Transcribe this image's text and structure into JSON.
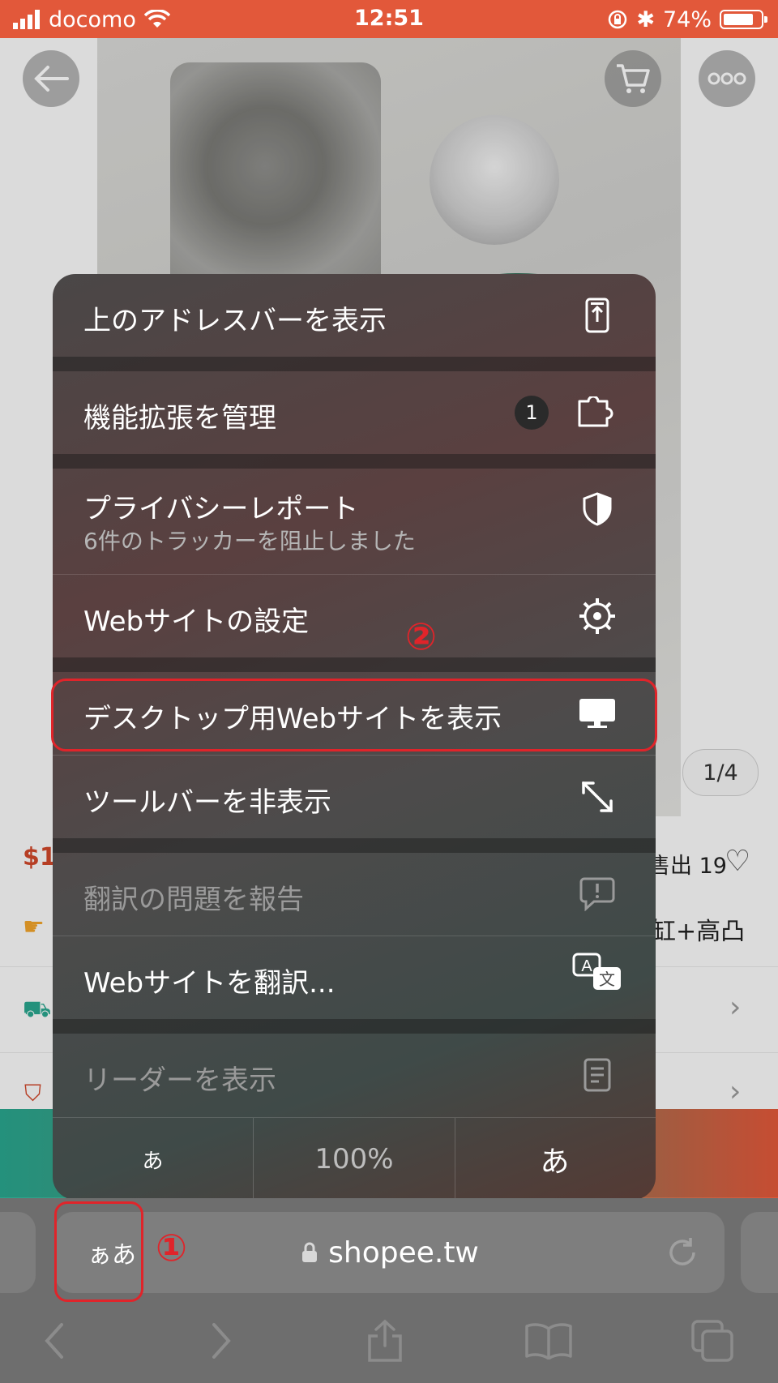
{
  "status_bar": {
    "carrier": "docomo",
    "time": "12:51",
    "battery": "74%"
  },
  "page": {
    "image_counter": "1/4",
    "price_partial": "$1",
    "sold_partial": "售出 19",
    "subtitle_partial": "缸+高凸"
  },
  "menu": {
    "items": [
      {
        "label": "上のアドレスバーを表示"
      },
      {
        "label": "機能拡張を管理",
        "badge": "1"
      },
      {
        "label": "プライバシーレポート",
        "sub": "6件のトラッカーを阻止しました"
      },
      {
        "label": "Webサイトの設定"
      },
      {
        "label": "デスクトップ用Webサイトを表示"
      },
      {
        "label": "ツールバーを非表示"
      },
      {
        "label": "翻訳の問題を報告"
      },
      {
        "label": "Webサイトを翻訳..."
      },
      {
        "label": "リーダーを表示"
      }
    ],
    "zoom": {
      "smaller": "あ",
      "level": "100%",
      "larger": "あ"
    }
  },
  "annotations": {
    "step1": "①",
    "step2": "②"
  },
  "toolbar": {
    "aa_button": "ぁあ",
    "url": "shopee.tw"
  },
  "colors": {
    "status_bar": "#e2583a",
    "highlight": "#e0242a"
  }
}
